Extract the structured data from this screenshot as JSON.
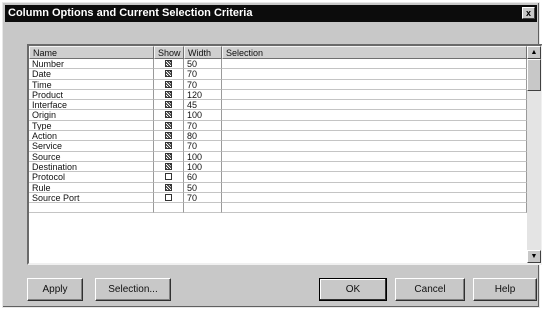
{
  "dialog": {
    "title": "Column Options and Current Selection Criteria",
    "close_glyph": "x"
  },
  "grid": {
    "headers": {
      "name": "Name",
      "show": "Show",
      "width": "Width",
      "selection": "Selection"
    },
    "rows": [
      {
        "name": "Number",
        "show": true,
        "width": "50",
        "selection": ""
      },
      {
        "name": "Date",
        "show": true,
        "width": "70",
        "selection": ""
      },
      {
        "name": "Time",
        "show": true,
        "width": "70",
        "selection": ""
      },
      {
        "name": "Product",
        "show": true,
        "width": "120",
        "selection": ""
      },
      {
        "name": "Interface",
        "show": true,
        "width": "45",
        "selection": ""
      },
      {
        "name": "Origin",
        "show": true,
        "width": "100",
        "selection": ""
      },
      {
        "name": "Type",
        "show": true,
        "width": "70",
        "selection": ""
      },
      {
        "name": "Action",
        "show": true,
        "width": "80",
        "selection": ""
      },
      {
        "name": "Service",
        "show": true,
        "width": "70",
        "selection": ""
      },
      {
        "name": "Source",
        "show": true,
        "width": "100",
        "selection": ""
      },
      {
        "name": "Destination",
        "show": true,
        "width": "100",
        "selection": ""
      },
      {
        "name": "Protocol",
        "show": false,
        "width": "60",
        "selection": ""
      },
      {
        "name": "Rule",
        "show": true,
        "width": "50",
        "selection": ""
      },
      {
        "name": "Source Port",
        "show": false,
        "width": "70",
        "selection": ""
      },
      {
        "name": "",
        "show": false,
        "width": "",
        "selection": ""
      }
    ]
  },
  "buttons": {
    "apply": "Apply",
    "selection": "Selection...",
    "ok": "OK",
    "cancel": "Cancel",
    "help": "Help"
  }
}
